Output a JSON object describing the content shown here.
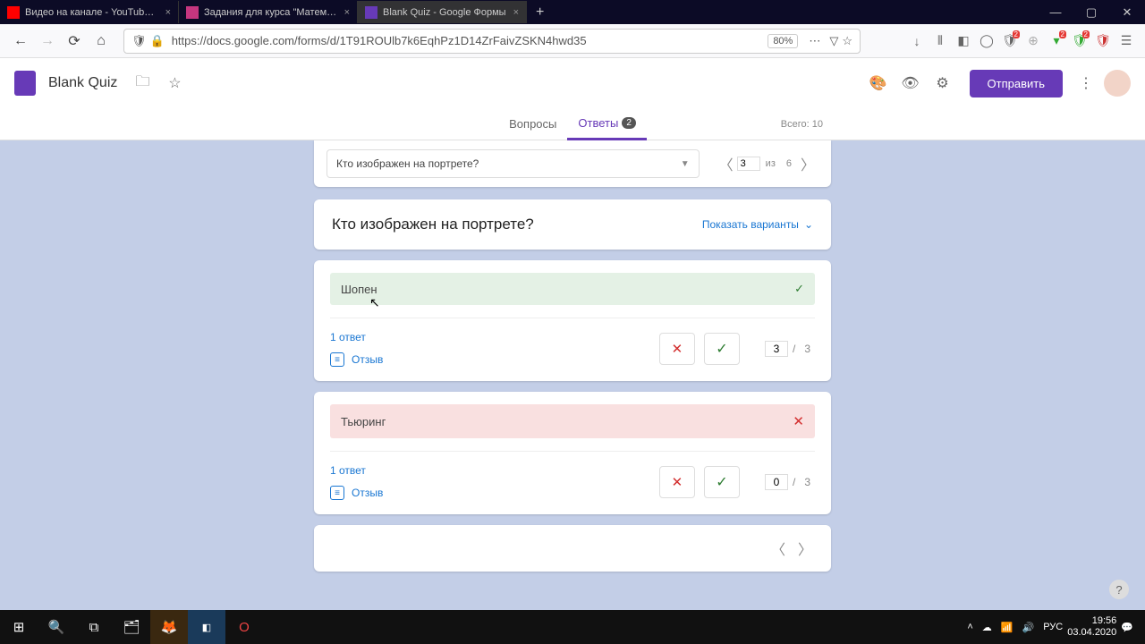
{
  "browser": {
    "tabs": [
      {
        "title": "Видео на канале - YouTube St"
      },
      {
        "title": "Задания для курса \"Математи"
      },
      {
        "title": "Blank Quiz - Google Формы"
      }
    ],
    "url": "https://docs.google.com/forms/d/1T91ROUlb7k6EqhPz1D14ZrFaivZSKN4hwd35",
    "zoom": "80%"
  },
  "forms": {
    "title": "Blank Quiz",
    "send": "Отправить",
    "tabs": {
      "questions": "Вопросы",
      "answers": "Ответы",
      "count": "2"
    },
    "total": "Всего: 10"
  },
  "selector": {
    "question": "Кто изображен на портрете?",
    "current": "3",
    "of_label": "из",
    "total": "6"
  },
  "question": {
    "text": "Кто изображен на портрете?",
    "show_options": "Показать варианты"
  },
  "answers": [
    {
      "text": "Шопен",
      "count": "1 ответ",
      "feedback": "Отзыв",
      "points": "3",
      "max": "3"
    },
    {
      "text": "Тьюринг",
      "count": "1 ответ",
      "feedback": "Отзыв",
      "points": "0",
      "max": "3"
    }
  ],
  "taskbar": {
    "lang": "РУС",
    "time": "19:56",
    "date": "03.04.2020"
  }
}
